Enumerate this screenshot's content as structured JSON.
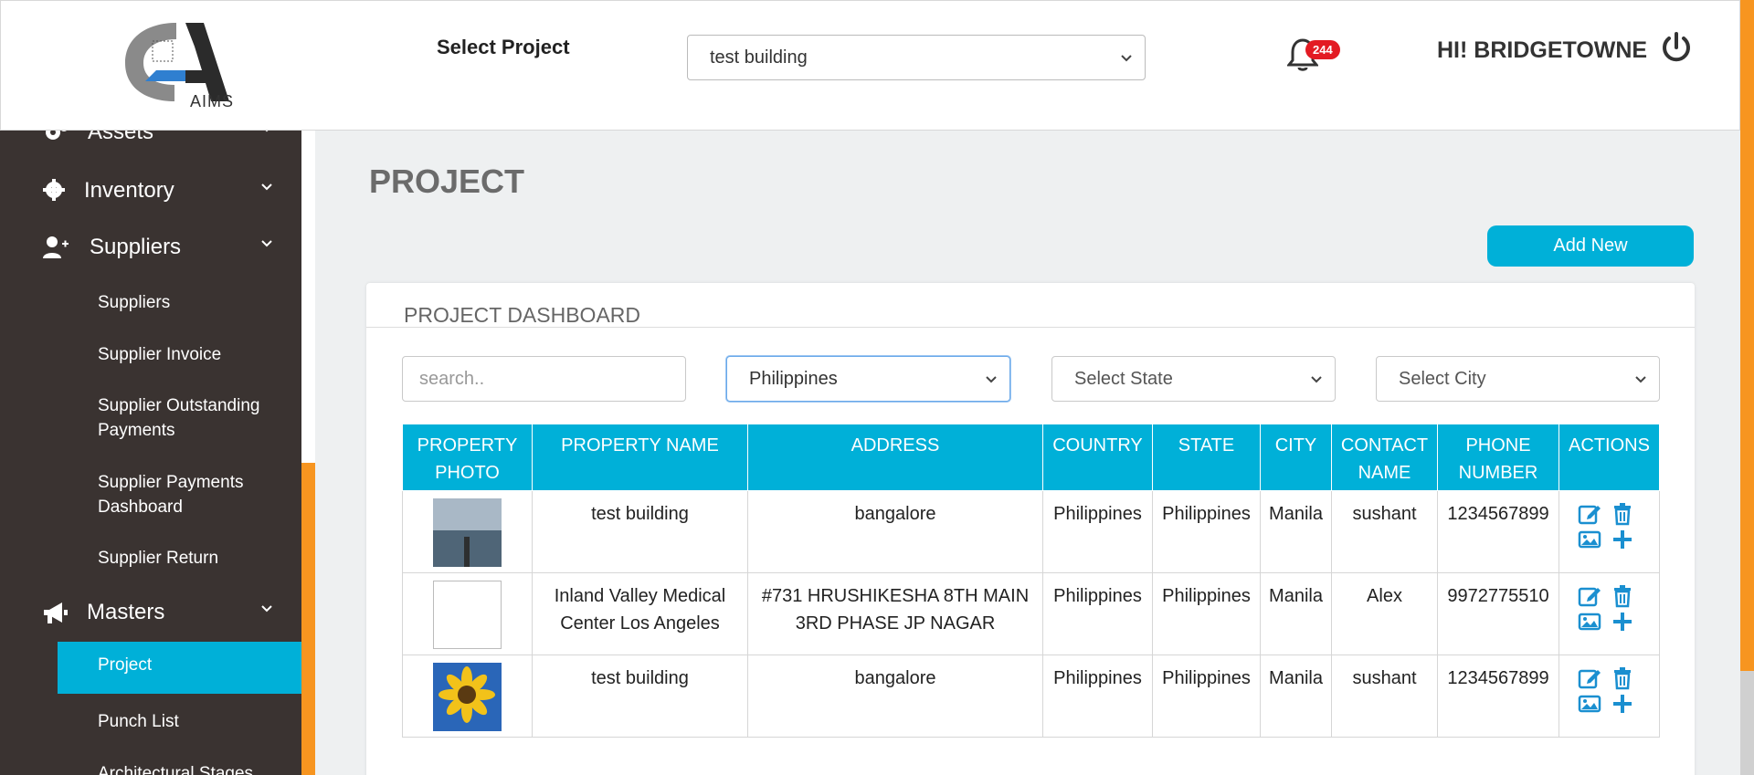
{
  "header": {
    "logo_text": "AIMS",
    "select_project_label": "Select Project",
    "selected_project": "test building",
    "notification_count": "244",
    "greeting": "HI! BRIDGETOWNE"
  },
  "sidebar": {
    "items": [
      {
        "label": "Assets",
        "icon": "gears-icon"
      },
      {
        "label": "Inventory",
        "icon": "gear-icon"
      },
      {
        "label": "Suppliers",
        "icon": "user-plus-icon"
      },
      {
        "label": "Masters",
        "icon": "megaphone-icon"
      }
    ],
    "supplier_sub": [
      "Suppliers",
      "Supplier Invoice",
      "Supplier Outstanding Payments",
      "Supplier Payments Dashboard",
      "Supplier Return"
    ],
    "masters_sub": [
      "Project",
      "Punch List",
      "Architectural Stages"
    ]
  },
  "main": {
    "page_title": "PROJECT",
    "add_new_label": "Add New",
    "card_title": "PROJECT DASHBOARD",
    "search_placeholder": "search..",
    "country_selected": "Philippines",
    "state_placeholder": "Select State",
    "city_placeholder": "Select City"
  },
  "table": {
    "headers": [
      "PROPERTY PHOTO",
      "PROPERTY NAME",
      "ADDRESS",
      "COUNTRY",
      "STATE",
      "CITY",
      "CONTACT NAME",
      "PHONE NUMBER",
      "ACTIONS"
    ],
    "rows": [
      {
        "photo": "pier-photo",
        "name": "test building",
        "address": "bangalore",
        "country": "Philippines",
        "state": "Philippines",
        "city": "Manila",
        "contact": "sushant",
        "phone": "1234567899"
      },
      {
        "photo": "broken-image",
        "name": "Inland Valley Medical Center Los Angeles",
        "address": "#731 HRUSHIKESHA 8TH MAIN 3RD PHASE JP NAGAR",
        "country": "Philippines",
        "state": "Philippines",
        "city": "Manila",
        "contact": "Alex",
        "phone": "9972775510"
      },
      {
        "photo": "sunflower-photo",
        "name": "test building",
        "address": "bangalore",
        "country": "Philippines",
        "state": "Philippines",
        "city": "Manila",
        "contact": "sushant",
        "phone": "1234567899"
      }
    ]
  },
  "colors": {
    "accent": "#00b0d8",
    "sidebar_bg": "#3a3331",
    "orange": "#f79520",
    "badge": "#e31b23"
  }
}
